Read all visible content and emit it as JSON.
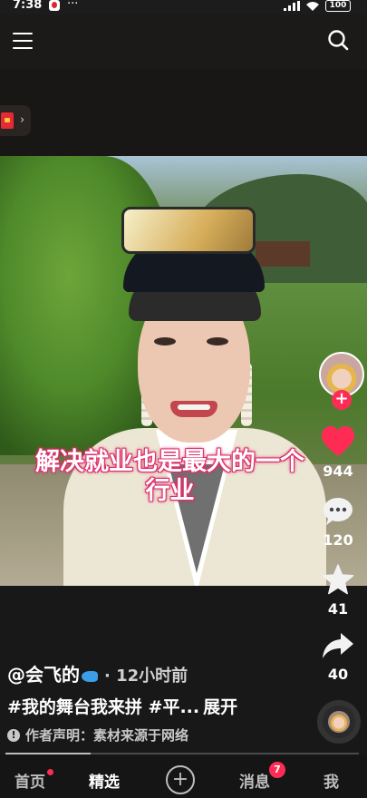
{
  "status_bar": {
    "time": "7:38",
    "more": "···",
    "battery": "100"
  },
  "video": {
    "subtitle_line1": "解决就业也是最大的一个",
    "subtitle_line2": "行业",
    "progress": 0.24
  },
  "actions": {
    "like_count": "944",
    "comment_count": "120",
    "favorite_count": "41",
    "share_count": "40"
  },
  "caption": {
    "author": "@会飞的",
    "time_ago": "· 12小时前",
    "description": "#我的舞台我来拼 #平...",
    "expand": "展开",
    "disclaimer": "作者声明：素材来源于网络"
  },
  "nav": {
    "home": "首页",
    "featured": "精选",
    "add": "+",
    "messages": "消息",
    "messages_badge": "7",
    "me": "我"
  },
  "colors": {
    "accent": "#fe2c55",
    "background": "#161616"
  },
  "icons": [
    "menu-icon",
    "search-icon",
    "red-envelope-icon",
    "heart-icon",
    "comment-icon",
    "star-icon",
    "share-icon",
    "music-disc-icon"
  ]
}
